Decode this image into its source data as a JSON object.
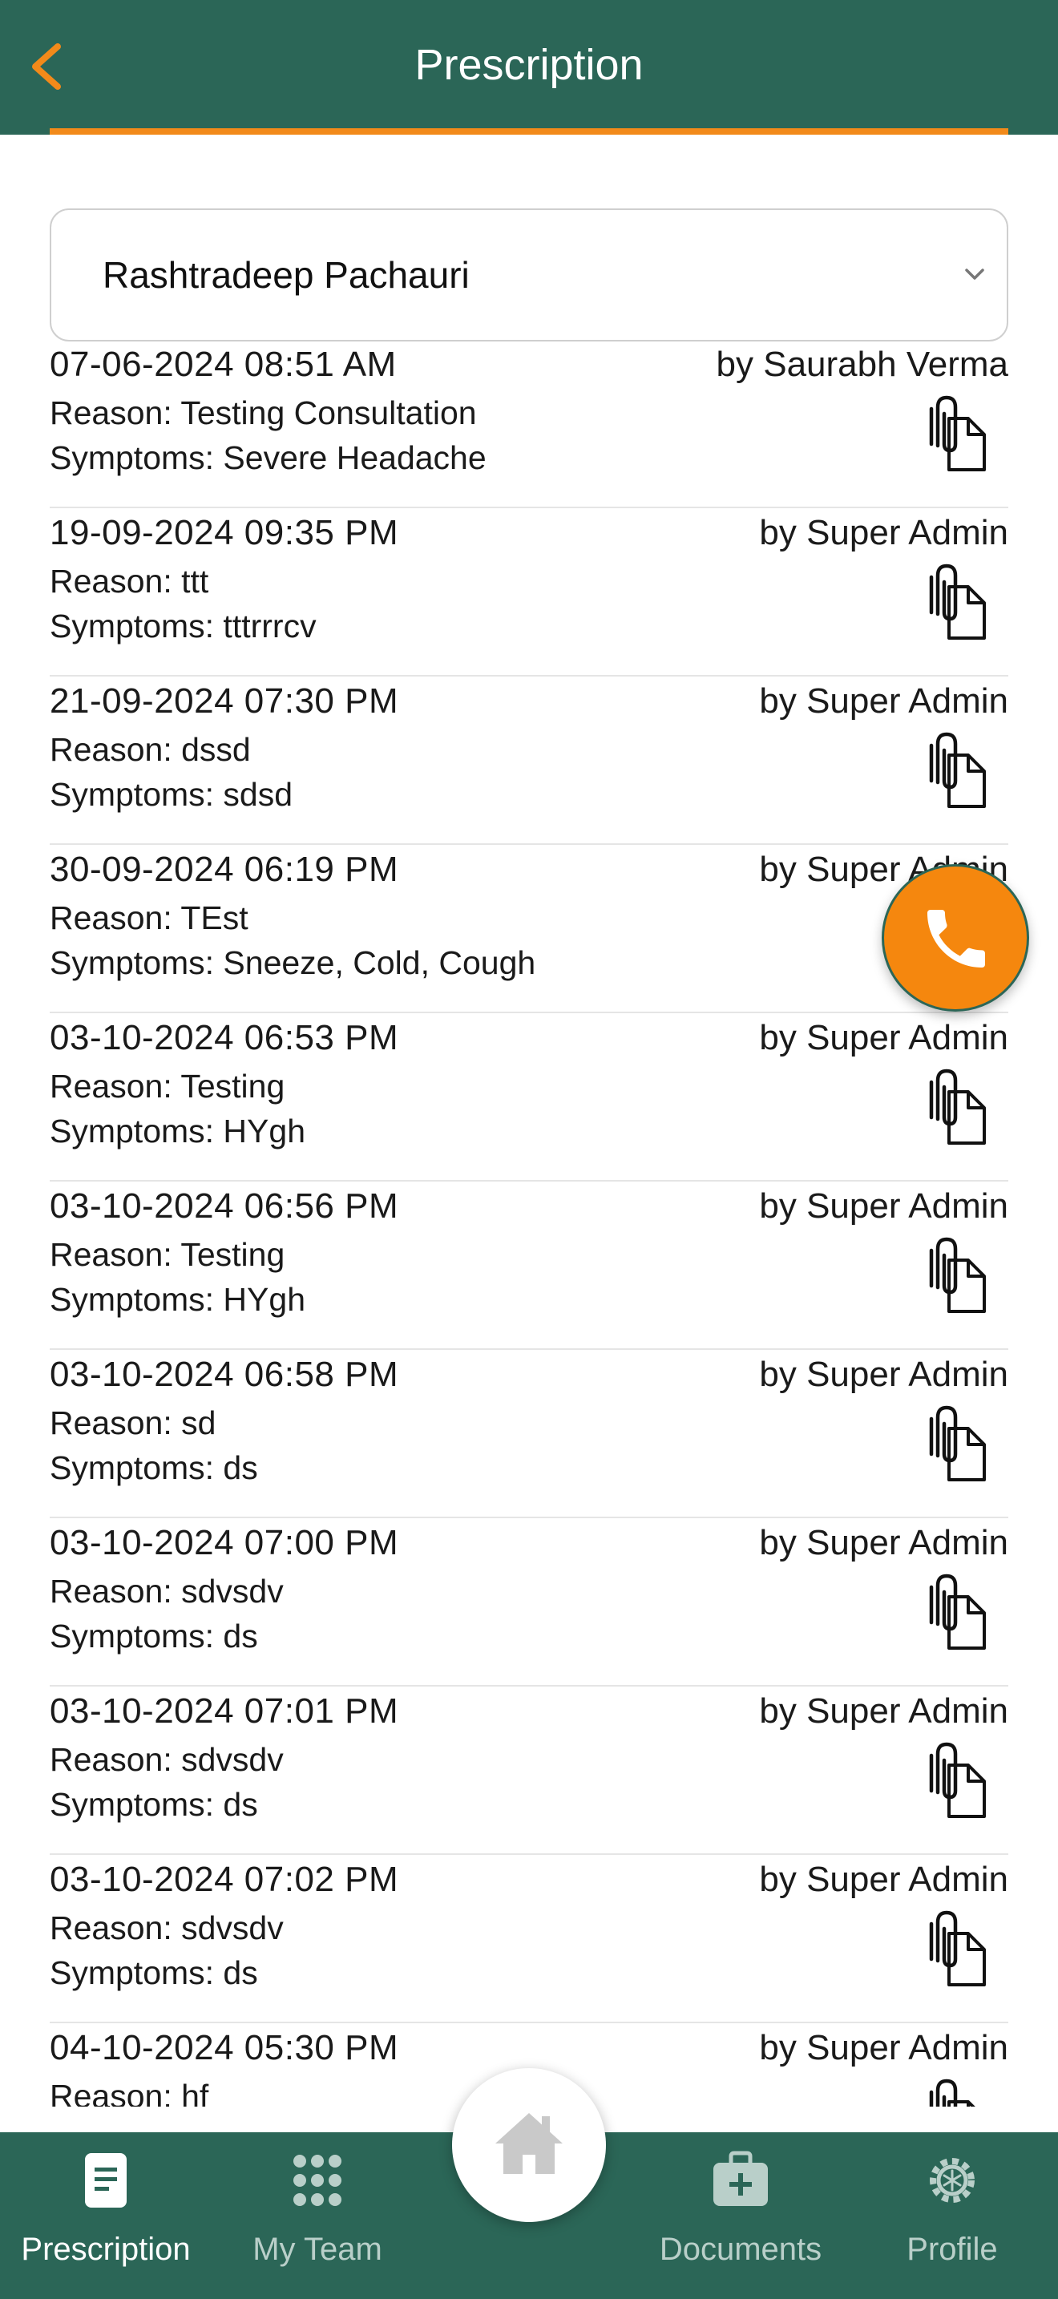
{
  "header": {
    "title": "Prescription",
    "back_icon": "chevron-left-icon",
    "accent_color": "#f28a1a",
    "bar_color": "#2b6657"
  },
  "patient_select": {
    "value": "Rashtradeep Pachauri",
    "icon": "chevron-down-icon"
  },
  "prescriptions": [
    {
      "date": "07-06-2024 08:51 AM",
      "by": "by Saurabh Verma",
      "reason": "Reason: Testing Consultation",
      "symptoms": "Symptoms: Severe Headache"
    },
    {
      "date": "19-09-2024 09:35 PM",
      "by": "by Super Admin",
      "reason": "Reason: ttt",
      "symptoms": "Symptoms: tttrrrcv"
    },
    {
      "date": "21-09-2024 07:30 PM",
      "by": "by Super Admin",
      "reason": "Reason: dssd",
      "symptoms": "Symptoms: sdsd"
    },
    {
      "date": "30-09-2024 06:19 PM",
      "by": "by Super Admin",
      "reason": "Reason: TEst",
      "symptoms": "Symptoms: Sneeze, Cold, Cough"
    },
    {
      "date": "03-10-2024 06:53 PM",
      "by": "by Super Admin",
      "reason": "Reason: Testing",
      "symptoms": "Symptoms: HYgh"
    },
    {
      "date": "03-10-2024 06:56 PM",
      "by": "by Super Admin",
      "reason": "Reason: Testing",
      "symptoms": "Symptoms: HYgh"
    },
    {
      "date": "03-10-2024 06:58 PM",
      "by": "by Super Admin",
      "reason": "Reason: sd",
      "symptoms": "Symptoms: ds"
    },
    {
      "date": "03-10-2024 07:00 PM",
      "by": "by Super Admin",
      "reason": "Reason: sdvsdv",
      "symptoms": "Symptoms: ds"
    },
    {
      "date": "03-10-2024 07:01 PM",
      "by": "by Super Admin",
      "reason": "Reason: sdvsdv",
      "symptoms": "Symptoms: ds"
    },
    {
      "date": "03-10-2024 07:02 PM",
      "by": "by Super Admin",
      "reason": "Reason: sdvsdv",
      "symptoms": "Symptoms: ds"
    },
    {
      "date": "04-10-2024 05:30 PM",
      "by": "by Super Admin",
      "reason": "Reason: hf",
      "symptoms": ""
    }
  ],
  "attachment_icon": "paperclip-document-icon",
  "call_button": {
    "icon": "phone-icon",
    "color": "#f5870e"
  },
  "bottom_nav": {
    "items": [
      {
        "label": "Prescription",
        "icon": "document-icon",
        "active": true
      },
      {
        "label": "My Team",
        "icon": "grid-icon",
        "active": false
      },
      {
        "label": "Documents",
        "icon": "medical-kit-icon",
        "active": false
      },
      {
        "label": "Profile",
        "icon": "gear-icon",
        "active": false
      }
    ],
    "home_icon": "home-icon"
  }
}
